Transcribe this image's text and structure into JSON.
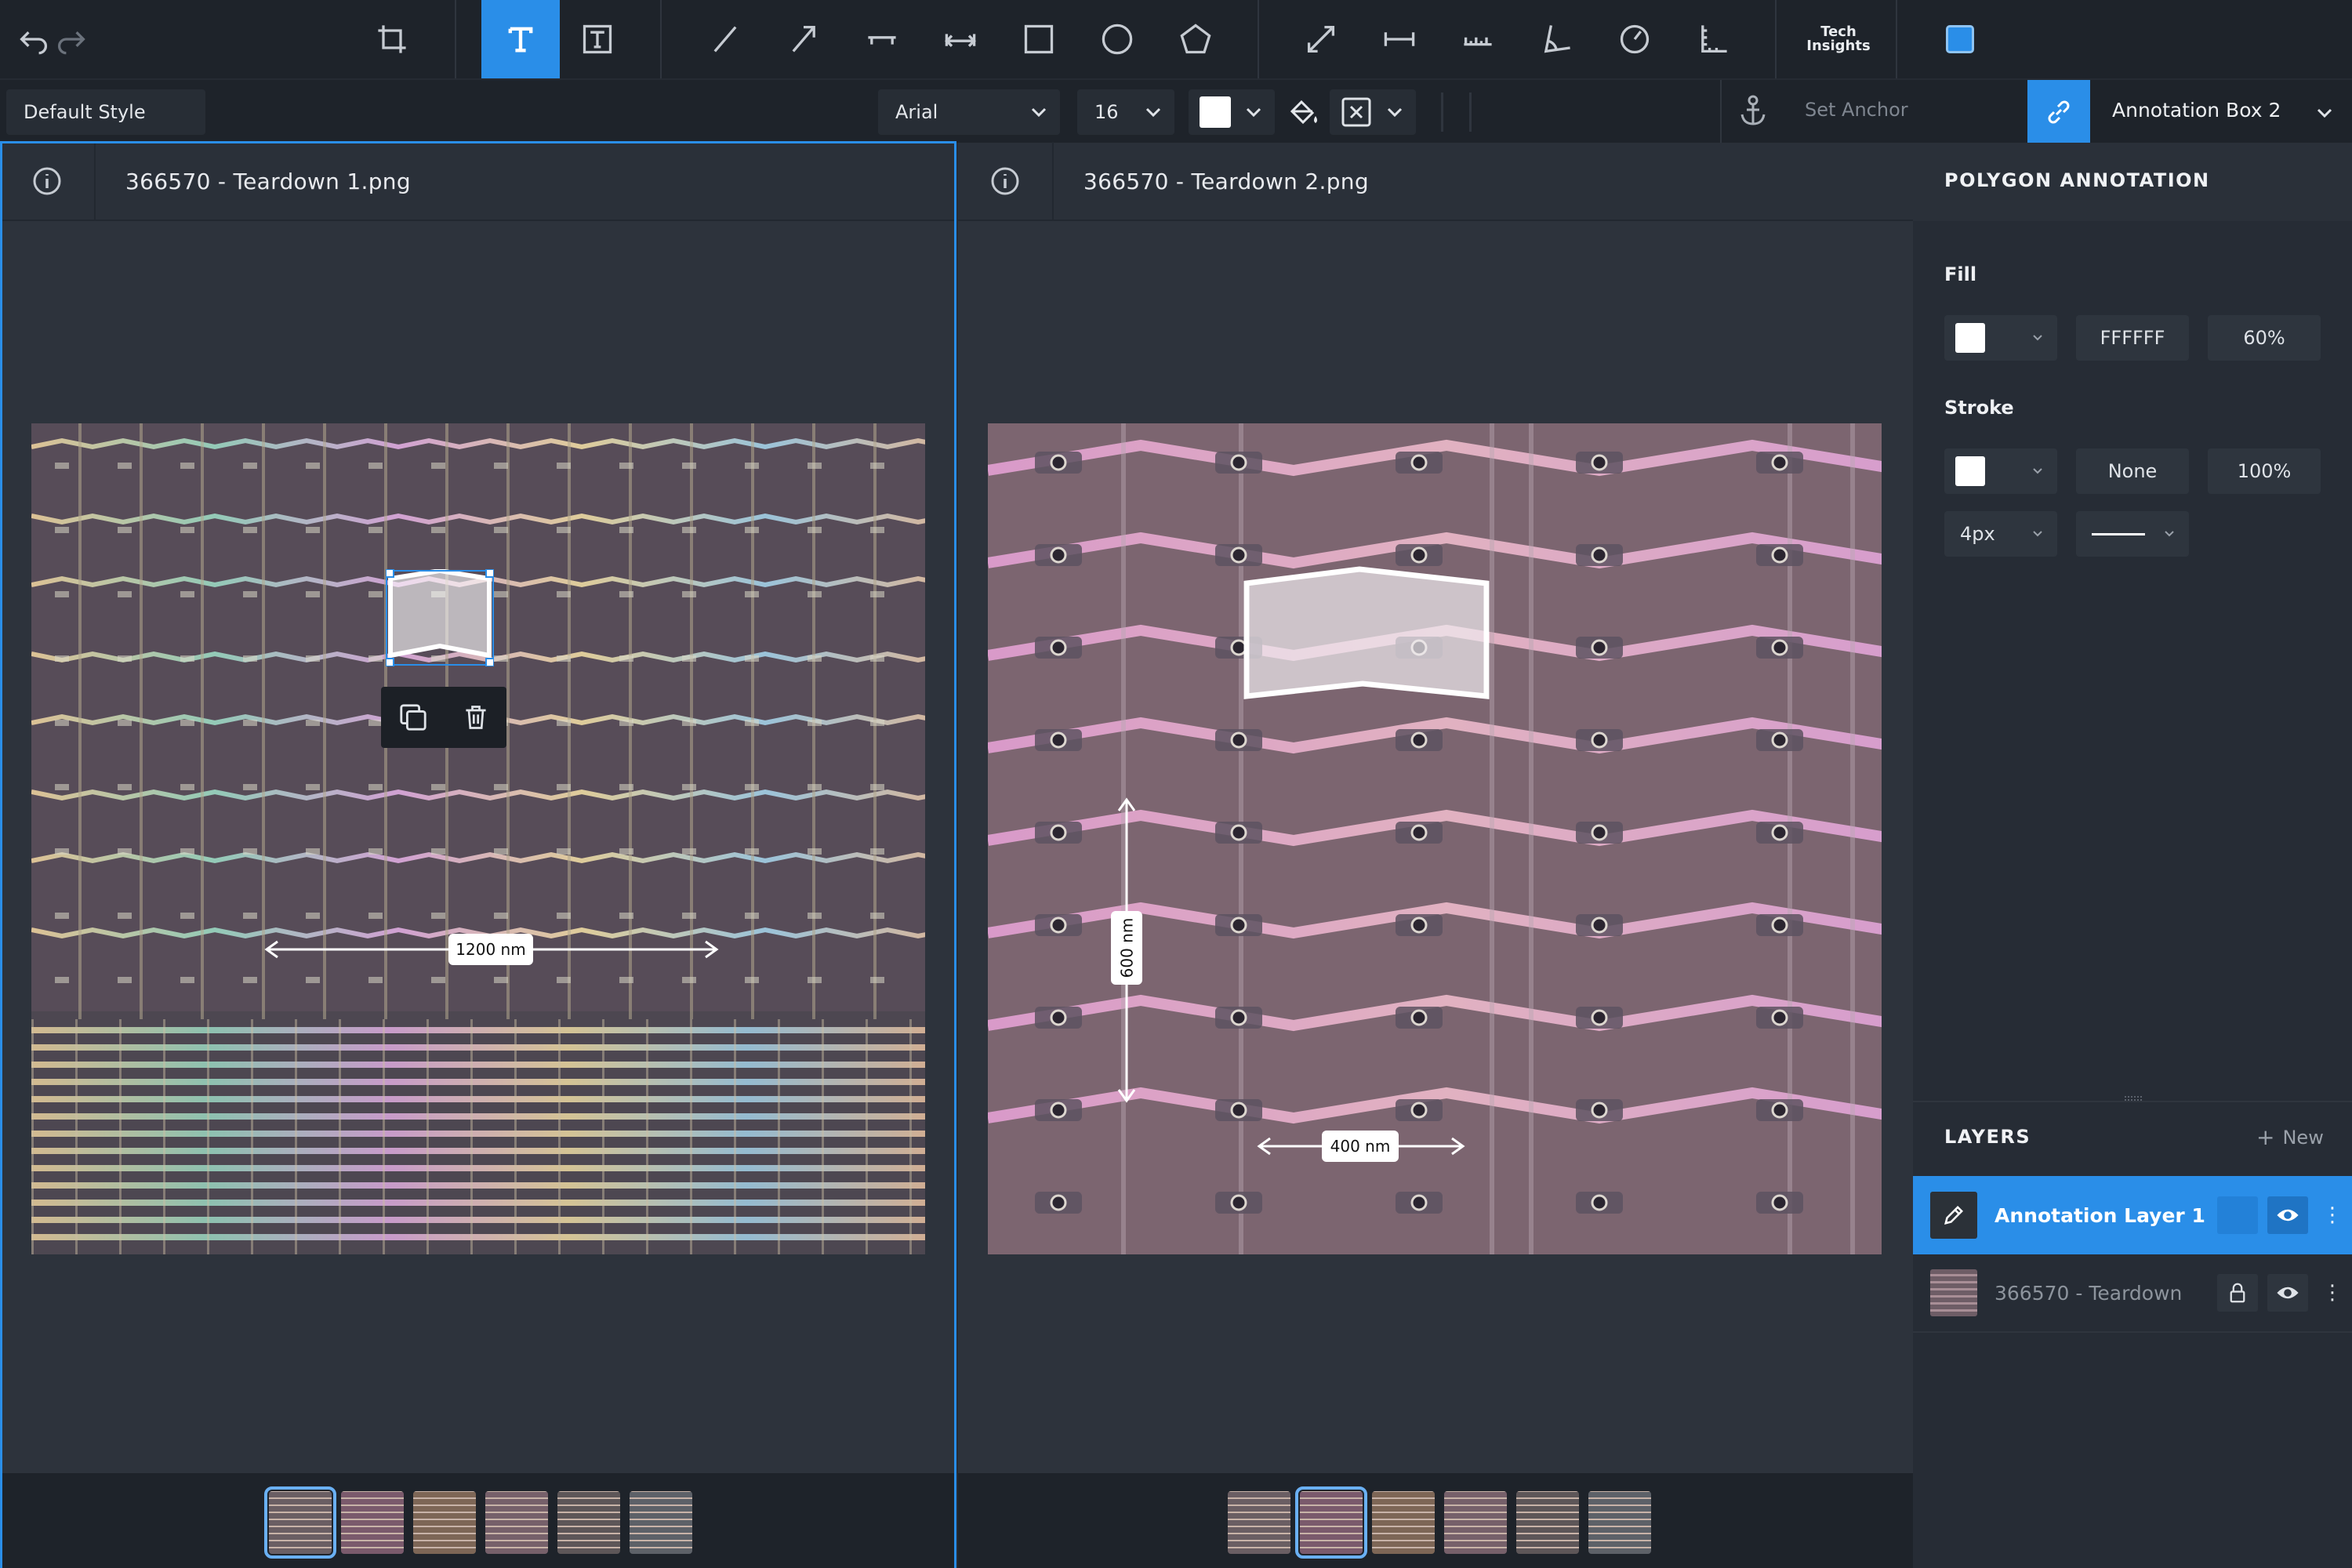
{
  "toolbar": {
    "tools": [
      "undo-icon",
      "redo-icon",
      "crop-icon",
      "text-icon",
      "text-box-icon",
      "line-icon",
      "arrow-icon",
      "dimension-line-icon",
      "bracket-dimension-icon",
      "rectangle-icon",
      "ellipse-icon",
      "polygon-icon",
      "double-arrow-icon",
      "measure-icon",
      "ruler-icon",
      "angle-icon",
      "gauge-icon",
      "axis-icon",
      "techinsights-logo",
      "color-icon"
    ],
    "active_tool": "text-icon",
    "logo_line1": "Tech",
    "logo_line2": "Insights",
    "accent": "#2a8ee8"
  },
  "style_bar": {
    "style_preset": "Default Style",
    "font": "Arial",
    "font_size": "16",
    "text_color": "#ffffff",
    "anchor_placeholder": "Set Anchor",
    "annotation_name": "Annotation Box 2"
  },
  "left_pane": {
    "filename": "366570 - Teardown 1.png",
    "measurement": "1200 nm",
    "selected_thumb": 0,
    "thumbs": 6
  },
  "right_pane": {
    "filename": "366570 - Teardown 2.png",
    "measurement_v": "600 nm",
    "measurement_h": "400 nm",
    "selected_thumb": 1,
    "thumbs": 6
  },
  "panel": {
    "title": "POLYGON ANNOTATION",
    "fill_label": "Fill",
    "fill_hex": "FFFFFF",
    "fill_opacity": "60%",
    "stroke_label": "Stroke",
    "stroke_color": "None",
    "stroke_opacity": "100%",
    "stroke_width": "4px",
    "layers_title": "LAYERS",
    "new_label": "New",
    "layers": [
      {
        "name": "Annotation Layer 1",
        "active": true
      },
      {
        "name": "366570 - Teardown",
        "active": false
      }
    ]
  }
}
